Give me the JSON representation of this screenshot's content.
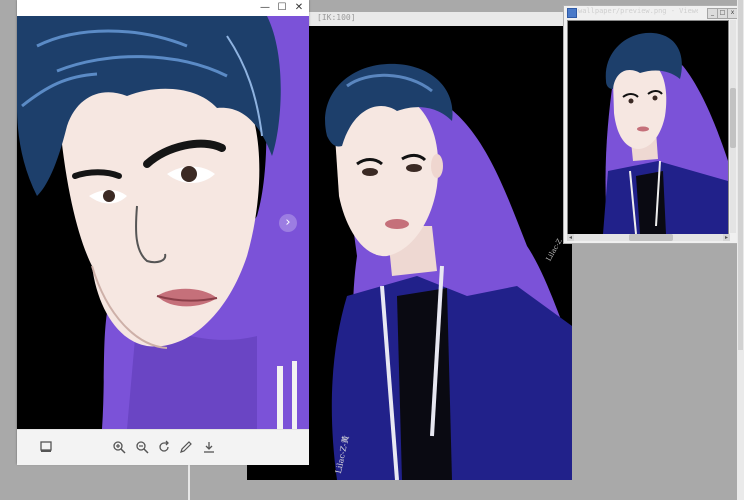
{
  "canvas_window": {
    "title": "[IK:100]",
    "signature": "Lilac-Z-黄",
    "signature_small": "Lilac-Z"
  },
  "viewer": {
    "window_buttons": {
      "minimize": "—",
      "maximize": "☐",
      "close": "✕"
    },
    "toolbar_icons": [
      "slideshow-icon",
      "zoom-in-icon",
      "zoom-out-icon",
      "rotate-icon",
      "edit-icon",
      "download-icon"
    ],
    "next_arrow": "›"
  },
  "preview_window": {
    "title": "wallpaper/preview.png - Viewer",
    "buttons": {
      "minimize": "_",
      "maximize": "□",
      "close": "x"
    }
  },
  "colors": {
    "desktop": "#a9a9a9",
    "hoodie_purple": "#7a4fd6",
    "jacket_navy": "#1e1f85",
    "hair_blue": "#1d3f6b",
    "skin": "#f6e7e1"
  }
}
